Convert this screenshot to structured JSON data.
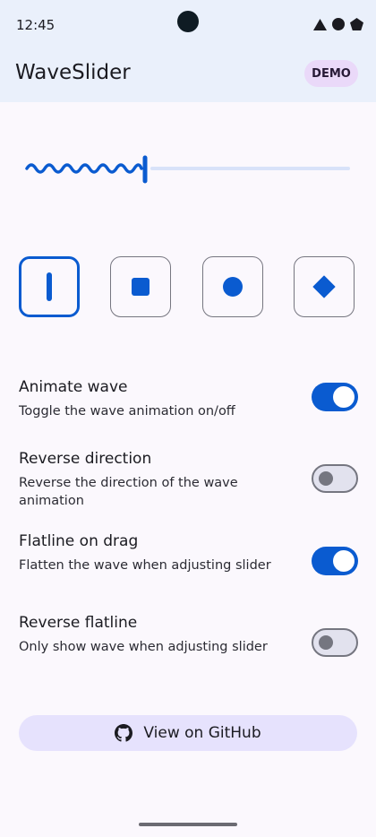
{
  "status_bar": {
    "time": "12:45",
    "icons": [
      "triangle-icon",
      "circle-icon",
      "pentagon-icon"
    ]
  },
  "app_bar": {
    "title": "WaveSlider",
    "badge": "DEMO"
  },
  "slider": {
    "value": 0.35,
    "accent_color": "#0a5bd0",
    "track_color": "#d8e2f9"
  },
  "shapes": {
    "selected": "line",
    "options": [
      "line-thumb-icon",
      "square-thumb-icon",
      "circle-thumb-icon",
      "diamond-thumb-icon"
    ]
  },
  "settings": [
    {
      "title": "Animate wave",
      "description": "Toggle the wave animation on/off",
      "enabled": true
    },
    {
      "title": "Reverse direction",
      "description": "Reverse the direction of the wave animation",
      "enabled": false
    },
    {
      "title": "Flatline on drag",
      "description": "Flatten the wave when adjusting slider",
      "enabled": true
    },
    {
      "title": "Reverse flatline",
      "description": "Only show wave when adjusting slider",
      "enabled": false
    }
  ],
  "github_button": {
    "label": "View on GitHub",
    "icon": "github-icon"
  },
  "colors": {
    "accent": "#0a5bd0",
    "header_bg": "#eaf0fb",
    "badge_bg": "#ead9f9",
    "button_bg": "#e6e2fd"
  }
}
